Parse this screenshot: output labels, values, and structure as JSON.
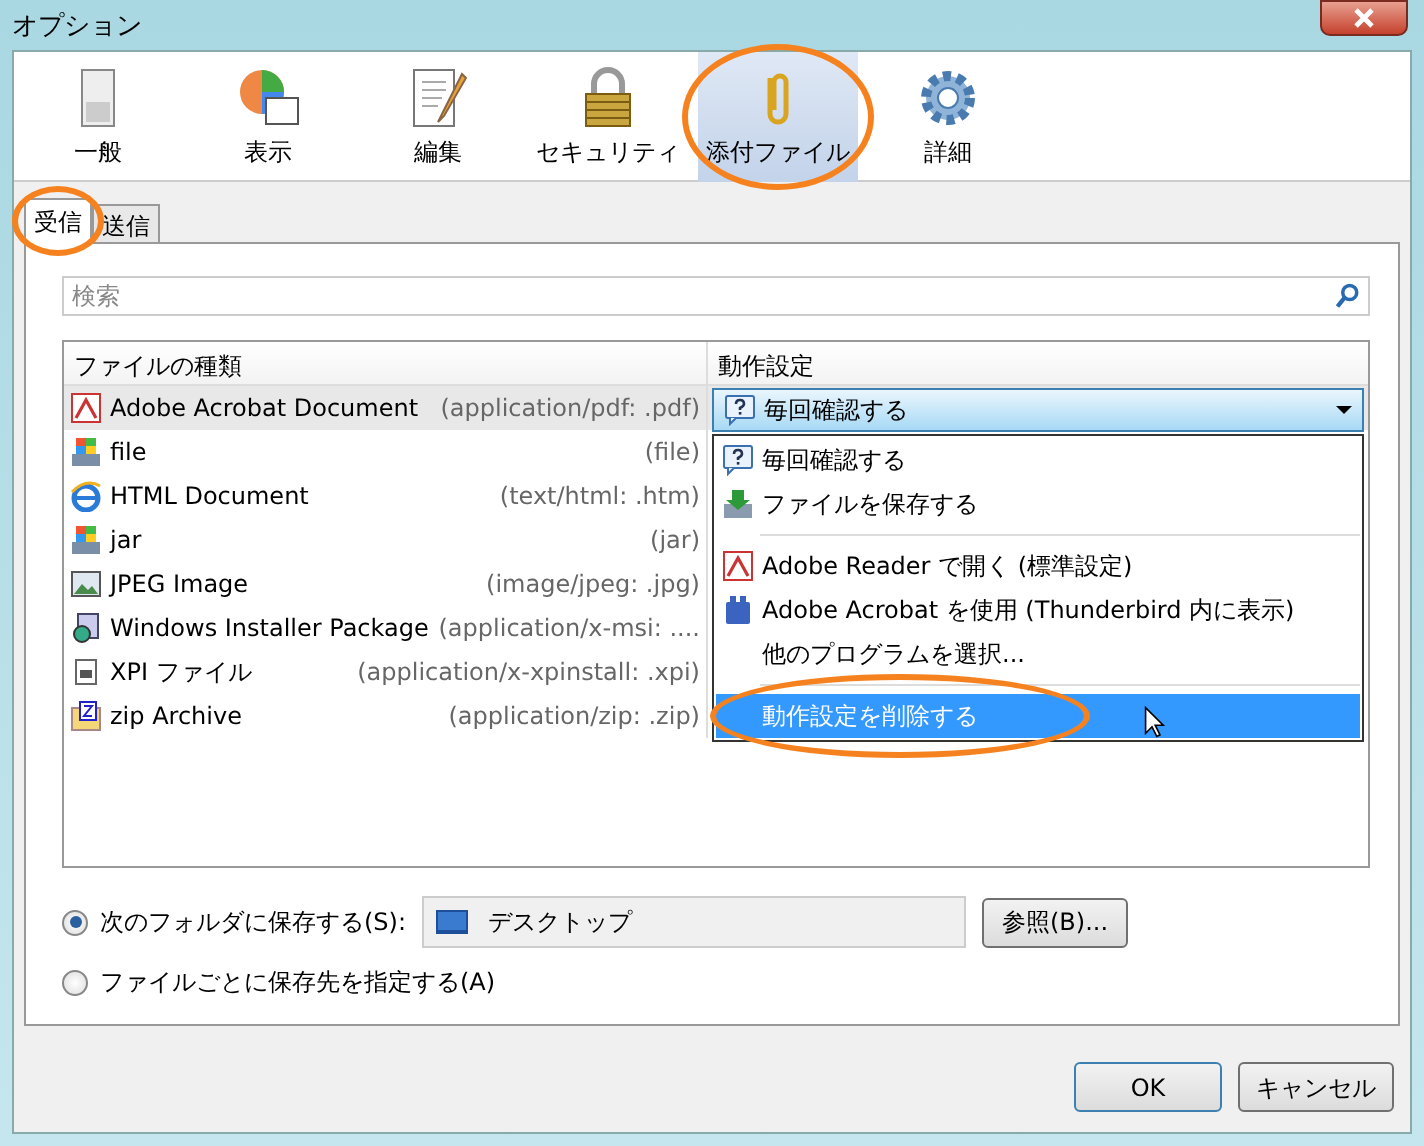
{
  "window": {
    "title": "オプション"
  },
  "toolbar": [
    {
      "label": "一般",
      "selected": false,
      "circled": false
    },
    {
      "label": "表示",
      "selected": false,
      "circled": false
    },
    {
      "label": "編集",
      "selected": false,
      "circled": false
    },
    {
      "label": "セキュリティ",
      "selected": false,
      "circled": false
    },
    {
      "label": "添付ファイル",
      "selected": true,
      "circled": true
    },
    {
      "label": "詳細",
      "selected": false,
      "circled": false
    }
  ],
  "tabs": [
    {
      "label": "受信",
      "selected": true,
      "circled": true
    },
    {
      "label": "送信",
      "selected": false,
      "circled": false
    }
  ],
  "search": {
    "placeholder": "検索"
  },
  "table": {
    "columns": [
      "ファイルの種類",
      "動作設定"
    ],
    "rows": [
      {
        "name": "Adobe Acrobat Document",
        "type": "(application/pdf: .pdf)",
        "selected": true
      },
      {
        "name": "file",
        "type": "(file)",
        "selected": false
      },
      {
        "name": "HTML Document",
        "type": "(text/html: .htm)",
        "selected": false
      },
      {
        "name": "jar",
        "type": "(jar)",
        "selected": false
      },
      {
        "name": "JPEG Image",
        "type": "(image/jpeg: .jpg)",
        "selected": false
      },
      {
        "name": "Windows Installer Package",
        "type": "(application/x-msi: ....",
        "selected": false
      },
      {
        "name": "XPI ファイル",
        "type": "(application/x-xpinstall: .xpi)",
        "selected": false
      },
      {
        "name": "zip Archive",
        "type": "(application/zip: .zip)",
        "selected": false
      }
    ]
  },
  "action_dropdown": {
    "value": "毎回確認する"
  },
  "action_menu": [
    {
      "kind": "item",
      "label": "毎回確認する",
      "selected": false,
      "circled": false
    },
    {
      "kind": "item",
      "label": "ファイルを保存する",
      "selected": false,
      "circled": false
    },
    {
      "kind": "separator"
    },
    {
      "kind": "item",
      "label": "Adobe Reader  で開く (標準設定)",
      "selected": false,
      "circled": false
    },
    {
      "kind": "item",
      "label": "Adobe Acrobat を使用 (Thunderbird 内に表示)",
      "selected": false,
      "circled": false
    },
    {
      "kind": "item",
      "label": "他のプログラムを選択...",
      "selected": false,
      "circled": false
    },
    {
      "kind": "separator"
    },
    {
      "kind": "item",
      "label": "動作設定を削除する",
      "selected": true,
      "circled": true
    }
  ],
  "save_options": [
    {
      "label": "次のフォルダに保存する(S):",
      "checked": true
    },
    {
      "label": "ファイルごとに保存先を指定する(A)",
      "checked": false
    }
  ],
  "folder": {
    "value": "デスクトップ"
  },
  "browse_button": "参照(B)...",
  "buttons": [
    "OK",
    "キャンセル"
  ]
}
